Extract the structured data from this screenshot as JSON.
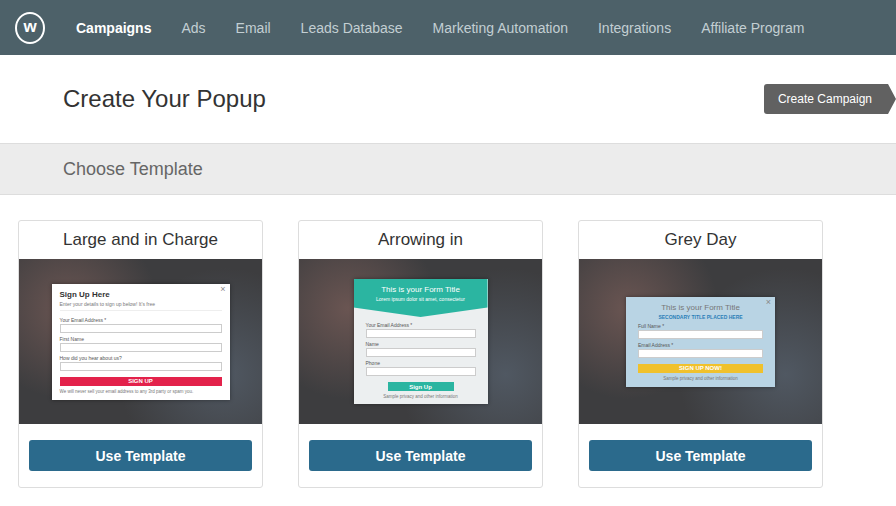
{
  "nav": {
    "logo": "w",
    "items": [
      {
        "label": "Campaigns",
        "selected": true
      },
      {
        "label": "Ads",
        "selected": false
      },
      {
        "label": "Email",
        "selected": false
      },
      {
        "label": "Leads Database",
        "selected": false
      },
      {
        "label": "Marketing Automation",
        "selected": false
      },
      {
        "label": "Integrations",
        "selected": false
      },
      {
        "label": "Affiliate Program",
        "selected": false
      }
    ]
  },
  "header": {
    "title": "Create Your Popup",
    "button": "Create Campaign"
  },
  "section": {
    "title": "Choose Template"
  },
  "templates": [
    {
      "title": "Large and in Charge",
      "button": "Use Template",
      "preview": {
        "kind": "plain",
        "color": "#e3224b",
        "close": "×",
        "title": "Sign Up Here",
        "subtitle": "Enter your details to sign up below! It's free",
        "fields": [
          "Your Email Address *",
          "First Name",
          "How did you hear about us?"
        ],
        "submit": "SIGN UP",
        "footnote": "We will never sell your email address to any 3rd party or spam you."
      }
    },
    {
      "title": "Arrowing in",
      "button": "Use Template",
      "preview": {
        "kind": "arrow",
        "color": "#2bb5a1",
        "close": "×",
        "title": "This is your Form Title",
        "subtitle": "Lorem ipsum dolor sit amet, consectetur",
        "fields": [
          "Your Email Address *",
          "Name",
          "Phone"
        ],
        "submit": "Sign Up",
        "footnote": "Sample privacy and other information"
      }
    },
    {
      "title": "Grey Day",
      "button": "Use Template",
      "preview": {
        "kind": "tinted",
        "color": "#f0c12c",
        "close": "×",
        "title": "This is your Form Title",
        "subtitle": "SECONDARY TITLE PLACED HERE",
        "fields": [
          "Full Name *",
          "Email Address *"
        ],
        "submit": "SIGN UP NOW!",
        "footnote": "Sample privacy and other information"
      }
    }
  ]
}
